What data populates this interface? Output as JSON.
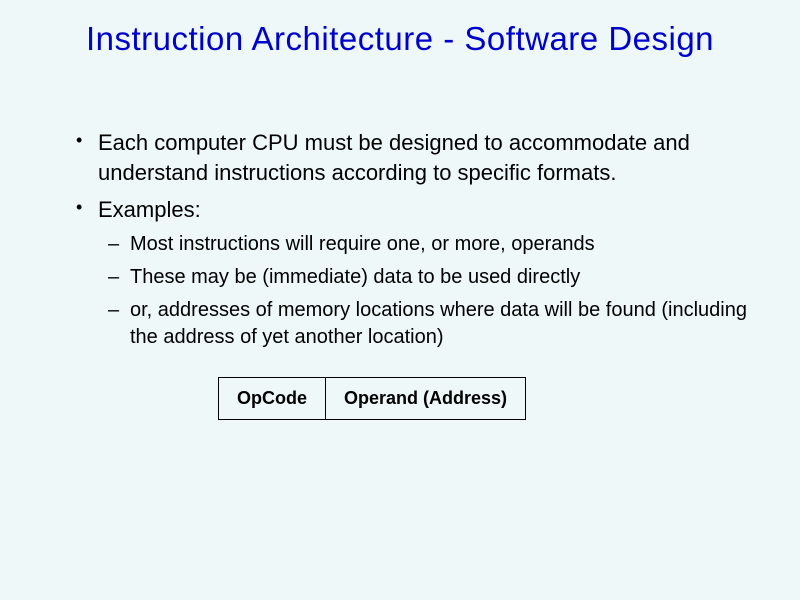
{
  "title": "Instruction Architecture - Software Design",
  "bullets": {
    "b1": "Each computer CPU must be designed to accommodate and understand instructions according to specific formats.",
    "b2": "Examples:",
    "sub1": "Most instructions will require one, or more, operands",
    "sub2": "These may be (immediate) data to be used directly",
    "sub3": "or, addresses of memory locations where data will be found (including the address of yet another location)"
  },
  "diagram": {
    "cell1": "OpCode",
    "cell2": "Operand (Address)"
  }
}
